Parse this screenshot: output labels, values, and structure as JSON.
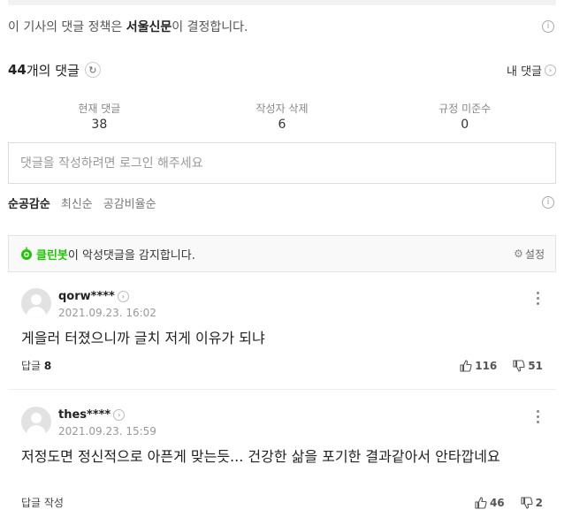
{
  "policy": {
    "prefix": "이 기사의 댓글 정책은 ",
    "publisher": "서울신문",
    "suffix": "이 결정합니다."
  },
  "count": {
    "number": "44",
    "suffix": "개의 댓글",
    "my_comments": "내 댓글"
  },
  "stats": [
    {
      "label": "현재 댓글",
      "value": "38"
    },
    {
      "label": "작성자 삭제",
      "value": "6"
    },
    {
      "label": "규정 미준수",
      "value": "0"
    }
  ],
  "input": {
    "placeholder": "댓글을 작성하려면 로그인 해주세요"
  },
  "sort": {
    "options": [
      "순공감순",
      "최신순",
      "공감비율순"
    ],
    "active": "순공감순"
  },
  "cleanbot": {
    "name": "클린봇",
    "text": "이 악성댓글을 감지합니다.",
    "settings": "설정"
  },
  "comments": [
    {
      "user": "qorw****",
      "date": "2021.09.23. 16:02",
      "text": "게을러 터졌으니까 글치 저게 이유가 되냐",
      "reply_label": "답글",
      "reply_count": "8",
      "likes": "116",
      "dislikes": "51"
    },
    {
      "user": "thes****",
      "date": "2021.09.23. 15:59",
      "text": "저정도면 정신적으로 아픈게 맞는듯... 건강한 삶을 포기한 결과같아서 안타깝네요",
      "reply_label": "답글 작성",
      "reply_count": "",
      "likes": "46",
      "dislikes": "2"
    }
  ],
  "icons": {
    "info": "info-icon",
    "refresh": "refresh-icon",
    "cleanbot": "cleanbot-icon",
    "settings": "gear-icon",
    "like": "thumb-up-icon",
    "dislike": "thumb-down-icon"
  }
}
